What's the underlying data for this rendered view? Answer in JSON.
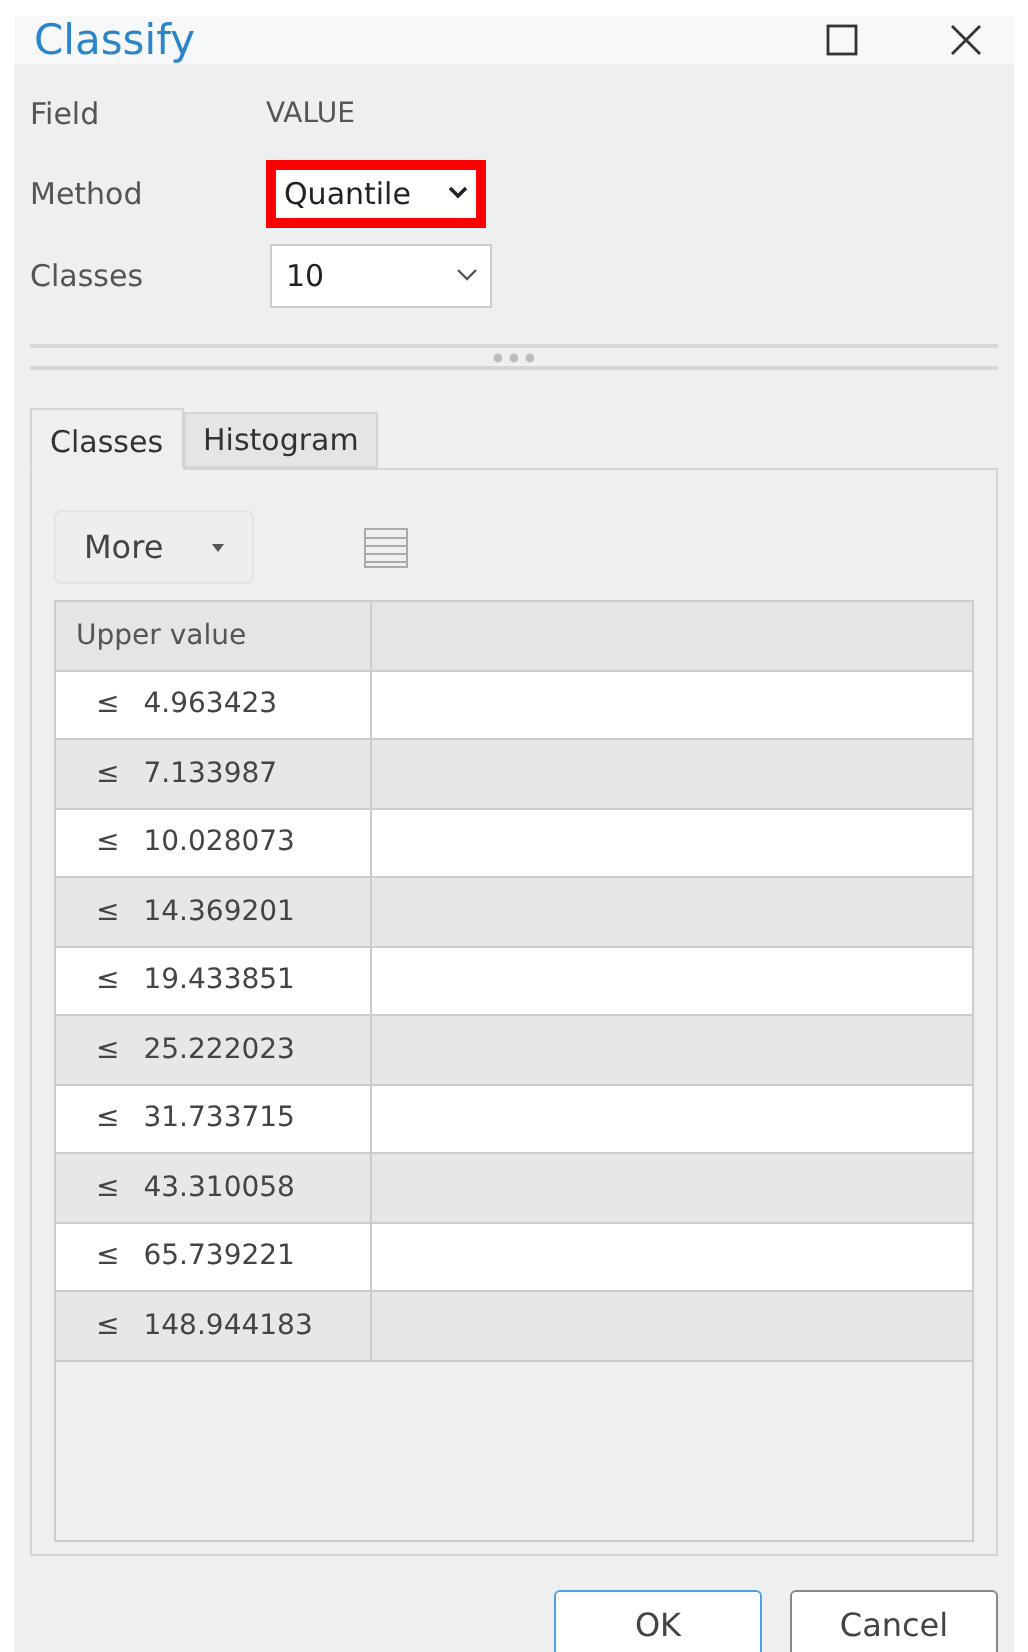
{
  "window": {
    "title": "Classify"
  },
  "form": {
    "field_label": "Field",
    "field_value": "VALUE",
    "method_label": "Method",
    "method_value": "Quantile",
    "method_highlighted": true,
    "classes_label": "Classes",
    "classes_value": "10"
  },
  "tabs": [
    {
      "label": "Classes",
      "selected": true
    },
    {
      "label": "Histogram",
      "selected": false
    }
  ],
  "toolbar": {
    "more": "More"
  },
  "table": {
    "columns": [
      "Upper value"
    ],
    "rows": [
      {
        "operator": "≤",
        "value": "4.963423"
      },
      {
        "operator": "≤",
        "value": "7.133987"
      },
      {
        "operator": "≤",
        "value": "10.028073"
      },
      {
        "operator": "≤",
        "value": "14.369201"
      },
      {
        "operator": "≤",
        "value": "19.433851"
      },
      {
        "operator": "≤",
        "value": "25.222023"
      },
      {
        "operator": "≤",
        "value": "31.733715"
      },
      {
        "operator": "≤",
        "value": "43.310058"
      },
      {
        "operator": "≤",
        "value": "65.739221"
      },
      {
        "operator": "≤",
        "value": "148.944183"
      }
    ]
  },
  "buttons": [
    {
      "label": "OK",
      "default": true
    },
    {
      "label": "Cancel",
      "default": false
    }
  ]
}
